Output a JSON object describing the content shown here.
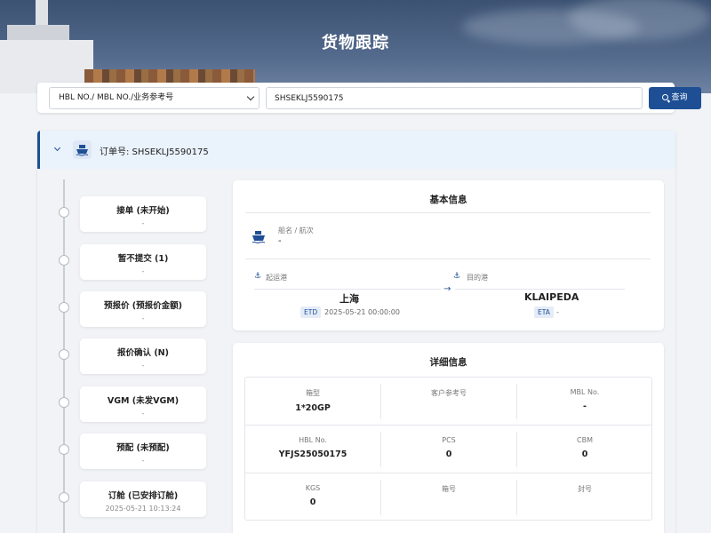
{
  "page": {
    "title": "货物跟踪"
  },
  "search": {
    "type_value": "HBL NO./ MBL NO./业务参考号",
    "query_value": "SHSEKLJ5590175",
    "button_label": "查询"
  },
  "order": {
    "label": "订单号: SHSEKLJ5590175"
  },
  "timeline": [
    {
      "title": "接单 (未开始)",
      "sub": "-"
    },
    {
      "title": "暂不提交 (1)",
      "sub": "-"
    },
    {
      "title": "预报价 (预报价金额)",
      "sub": "-"
    },
    {
      "title": "报价确认 (N)",
      "sub": "-"
    },
    {
      "title": "VGM (未发VGM)",
      "sub": "-"
    },
    {
      "title": "预配 (未预配)",
      "sub": "-"
    },
    {
      "title": "订舱 (已安排订舱)",
      "sub": "2025-05-21 10:13:24"
    }
  ],
  "basic": {
    "title": "基本信息",
    "vessel_label": "船名 / 航次",
    "vessel_value": "-",
    "pol_label": "起运港",
    "pol_value": "上海",
    "etd_badge": "ETD",
    "etd_value": "2025-05-21 00:00:00",
    "pod_label": "目的港",
    "pod_value": "KLAIPEDA",
    "eta_badge": "ETA",
    "eta_value": "-"
  },
  "detail": {
    "title": "详细信息",
    "cells": [
      {
        "key": "箱型",
        "value": "1*20GP"
      },
      {
        "key": "客户参考号",
        "value": ""
      },
      {
        "key": "MBL No.",
        "value": "-"
      },
      {
        "key": "HBL No.",
        "value": "YFJS25050175"
      },
      {
        "key": "PCS",
        "value": "0"
      },
      {
        "key": "CBM",
        "value": "0"
      },
      {
        "key": "KGS",
        "value": "0"
      },
      {
        "key": "箱号",
        "value": ""
      },
      {
        "key": "封号",
        "value": ""
      }
    ]
  }
}
